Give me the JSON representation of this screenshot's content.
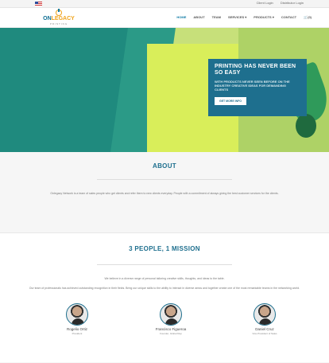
{
  "topbar": {
    "client_login": "Client Login",
    "distributor_login": "Distributor Login"
  },
  "logo": {
    "word_part1": "ON",
    "word_part2": "LEGACY",
    "subtitle": "PRINTING"
  },
  "nav": {
    "items": [
      "HOME",
      "ABOUT",
      "TEAM",
      "SERVICES ▾",
      "PRODUCTS ▾",
      "CONTACT"
    ],
    "cart": "(0)"
  },
  "hero": {
    "title": "PRINTING HAS NEVER BEEN SO EASY",
    "text": "WITH PRODUCTS NEVER SEEN BEFORE ON THE INDUSTRY CREATIVE IDEAS FOR DEMANDING CLIENTS",
    "button": "GET MORE INFO"
  },
  "about": {
    "title": "ABOUT",
    "text": "Onlegacy Network is a team of sales people who get clients and refer them to new clients everyday. People with a commitment of always giving the best customer services for the clients."
  },
  "mission": {
    "title": "3 PEOPLE, 1 MISSION",
    "line1": "We believe in a diverse range of personal tailoring creative skills, thoughts, and ideas to the table.",
    "line2": "Our team of professionals has achieved outstanding recognition in their fields. Bring our unique skills to the ability to interact in diverse areas and together create one of the most remarkable teams in the networking world."
  },
  "team": [
    {
      "name": "Rogelio Ortiz",
      "role": "President"
    },
    {
      "name": "Francisco Figueroa",
      "role": "Founder, Global Rep"
    },
    {
      "name": "Daniel Cruz",
      "role": "Vice-President of Sales"
    }
  ]
}
